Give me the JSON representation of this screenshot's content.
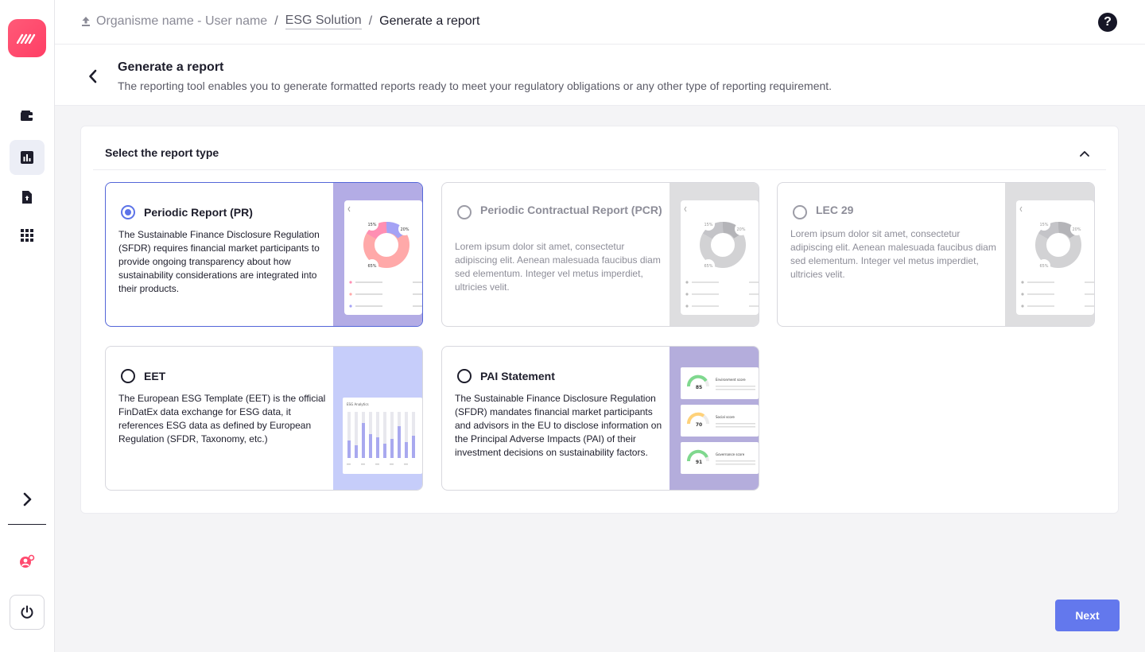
{
  "breadcrumb": {
    "org_user": "Organisme name - User name",
    "solution": "ESG Solution",
    "current": "Generate a report"
  },
  "header": {
    "title": "Generate a report",
    "subtitle": "The reporting tool enables you to generate formatted reports ready to meet your regulatory obligations or any other type of reporting requirement."
  },
  "panel": {
    "title": "Select the report type"
  },
  "cards": [
    {
      "title": "Periodic Report (PR)",
      "description": "The Sustainable Finance Disclosure Regulation (SFDR) requires financial market participants to provide ongoing transparency about how sustainability considerations are integrated into their products.",
      "state": "selected"
    },
    {
      "title": "Periodic Contractual Report (PCR)",
      "description": "Lorem ipsum dolor sit amet, consectetur adipiscing elit. Aenean malesuada faucibus diam sed elementum. Integer vel metus imperdiet, ultricies velit.",
      "state": "disabled"
    },
    {
      "title": "LEC 29",
      "description": "Lorem ipsum dolor sit amet, consectetur adipiscing elit. Aenean malesuada faucibus diam sed elementum. Integer vel metus imperdiet, ultricies velit.",
      "state": "disabled"
    },
    {
      "title": "EET",
      "description": "The European ESG Template (EET) is the official FinDatEx data exchange for ESG data, it references ESG data as defined by European Regulation (SFDR, Taxonomy, etc.)",
      "state": "unselected"
    },
    {
      "title": "PAI Statement",
      "description": "The Sustainable Finance Disclosure Regulation (SFDR) mandates financial market participants and advisors in the EU to disclose information on the Principal Adverse Impacts (PAI) of their investment decisions on sustainability factors.",
      "state": "unselected"
    }
  ],
  "preview": {
    "donut_labels": [
      "15%",
      "20%",
      "65%"
    ],
    "eet_title": "ESG Analytics",
    "pai_scores": [
      {
        "value": "85",
        "label": "Environment score"
      },
      {
        "value": "70",
        "label": "Social score"
      },
      {
        "value": "91",
        "label": "Governance score"
      }
    ]
  },
  "actions": {
    "next": "Next"
  },
  "colors": {
    "accent": "#6378ed",
    "selected_border": "#5466d8",
    "logo": "#ff4a6e",
    "pr_art_bg": "#b3ace5",
    "eet_art_bg": "#c6cdfa",
    "pai_art_bg": "#b4addc",
    "disabled_art_bg": "#dedee0"
  }
}
